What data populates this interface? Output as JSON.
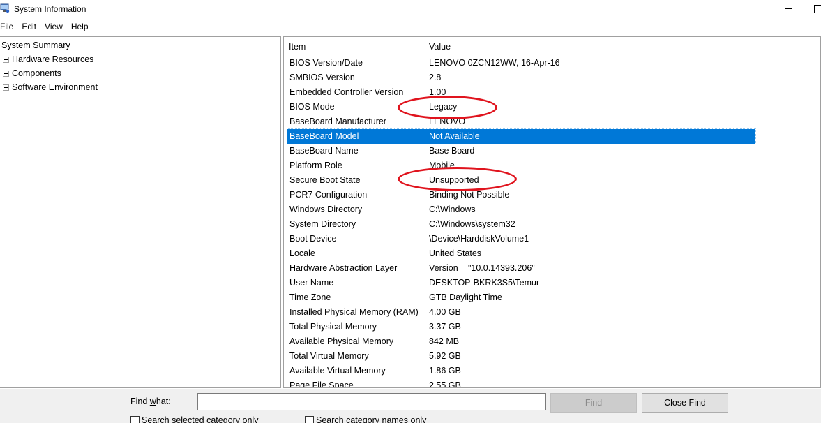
{
  "window": {
    "title": "System Information",
    "icon": "system-information-icon"
  },
  "menu": {
    "items": [
      "File",
      "Edit",
      "View",
      "Help"
    ]
  },
  "tree": {
    "root": "System Summary",
    "children": [
      "Hardware Resources",
      "Components",
      "Software Environment"
    ]
  },
  "list": {
    "headers": {
      "item": "Item",
      "value": "Value"
    },
    "rows": [
      {
        "item": "BIOS Version/Date",
        "value": "LENOVO 0ZCN12WW, 16-Apr-16"
      },
      {
        "item": "SMBIOS Version",
        "value": "2.8"
      },
      {
        "item": "Embedded Controller Version",
        "value": "1.00"
      },
      {
        "item": "BIOS Mode",
        "value": "Legacy"
      },
      {
        "item": "BaseBoard Manufacturer",
        "value": "LENOVO"
      },
      {
        "item": "BaseBoard Model",
        "value": "Not Available"
      },
      {
        "item": "BaseBoard Name",
        "value": "Base Board"
      },
      {
        "item": "Platform Role",
        "value": "Mobile"
      },
      {
        "item": "Secure Boot State",
        "value": "Unsupported"
      },
      {
        "item": "PCR7 Configuration",
        "value": "Binding Not Possible"
      },
      {
        "item": "Windows Directory",
        "value": "C:\\Windows"
      },
      {
        "item": "System Directory",
        "value": "C:\\Windows\\system32"
      },
      {
        "item": "Boot Device",
        "value": "\\Device\\HarddiskVolume1"
      },
      {
        "item": "Locale",
        "value": "United States"
      },
      {
        "item": "Hardware Abstraction Layer",
        "value": "Version = \"10.0.14393.206\""
      },
      {
        "item": "User Name",
        "value": "DESKTOP-BKRK3S5\\Temur"
      },
      {
        "item": "Time Zone",
        "value": "GTB Daylight Time"
      },
      {
        "item": "Installed Physical Memory (RAM)",
        "value": "4.00 GB"
      },
      {
        "item": "Total Physical Memory",
        "value": "3.37 GB"
      },
      {
        "item": "Available Physical Memory",
        "value": "842 MB"
      },
      {
        "item": "Total Virtual Memory",
        "value": "5.92 GB"
      },
      {
        "item": "Available Virtual Memory",
        "value": "1.86 GB"
      },
      {
        "item": "Page File Space",
        "value": "2.55 GB"
      }
    ],
    "selected_row": "BaseBoard Model"
  },
  "find": {
    "label": "Find what:",
    "value": "",
    "find_button": "Find",
    "close_button": "Close Find",
    "check_selected": "Search selected category only",
    "check_names": "Search category names only"
  },
  "colors": {
    "selection": "#0078d7",
    "annotation": "#e0141e"
  }
}
